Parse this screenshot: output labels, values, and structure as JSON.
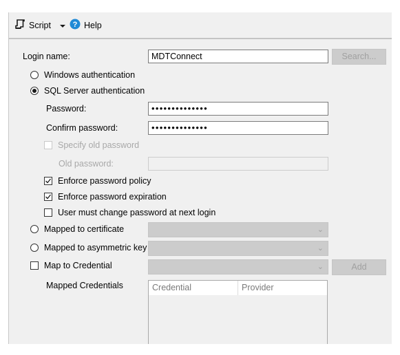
{
  "toolbar": {
    "script_label": "Script",
    "help_label": "Help",
    "script_icon": "script-icon",
    "help_icon": "help-icon"
  },
  "form": {
    "login_name_label": "Login name:",
    "login_name_value": "MDTConnect",
    "search_button": "Search...",
    "windows_auth_label": "Windows authentication",
    "sql_auth_label": "SQL Server authentication",
    "auth_selected": "sql",
    "password_label": "Password:",
    "password_value": "••••••••••••••",
    "confirm_password_label": "Confirm password:",
    "confirm_password_value": "••••••••••••••",
    "specify_old_password_label": "Specify old password",
    "specify_old_password_checked": false,
    "old_password_label": "Old password:",
    "old_password_value": "",
    "enforce_policy_label": "Enforce password policy",
    "enforce_policy_checked": true,
    "enforce_expiration_label": "Enforce password expiration",
    "enforce_expiration_checked": true,
    "must_change_label": "User must change password at next login",
    "must_change_checked": false,
    "mapped_certificate_label": "Mapped to certificate",
    "mapped_certificate_value": "",
    "mapped_asym_key_label": "Mapped to asymmetric key",
    "mapped_asym_key_value": "",
    "map_credential_label": "Map to Credential",
    "map_credential_checked": false,
    "map_credential_value": "",
    "add_button": "Add",
    "mapped_credentials_label": "Mapped Credentials",
    "credentials_table": {
      "columns": [
        "Credential",
        "Provider"
      ],
      "rows": []
    }
  }
}
